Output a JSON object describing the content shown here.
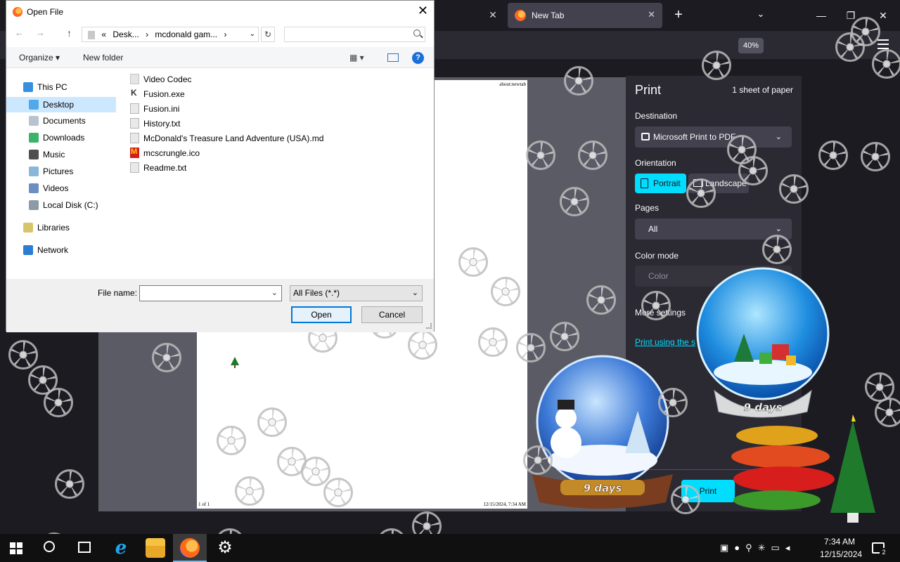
{
  "firefox": {
    "tab_title": "New Tab",
    "zoom": "40%"
  },
  "print_panel": {
    "title": "Print",
    "sheets": "1 sheet of paper",
    "destination_label": "Destination",
    "destination_value": "Microsoft Print to PDF",
    "orientation_label": "Orientation",
    "portrait": "Portrait",
    "landscape": "Landscape",
    "pages_label": "Pages",
    "pages_value": "All",
    "color_mode_label": "Color mode",
    "color_value": "Color",
    "more_settings": "More settings",
    "system_dialog_link": "Print using the s",
    "print_button": "Print"
  },
  "preview": {
    "header_url": "about:newtab",
    "footer_page": "1 of 1",
    "footer_date": "12/15/2024, 7:34 AM"
  },
  "globes": {
    "big_label": "9 days",
    "small_label": "9 days"
  },
  "dialog": {
    "title": "Open File",
    "address_prefix": "«",
    "address_part1": "Desk...",
    "address_part2": "mcdonald gam...",
    "address_sep": "›",
    "toolbar": {
      "organize": "Organize ▾",
      "new_folder": "New folder"
    },
    "nav_items": [
      {
        "label": "This PC"
      },
      {
        "label": "Desktop"
      },
      {
        "label": "Documents"
      },
      {
        "label": "Downloads"
      },
      {
        "label": "Music"
      },
      {
        "label": "Pictures"
      },
      {
        "label": "Videos"
      },
      {
        "label": "Local Disk (C:)"
      },
      {
        "label": "Libraries"
      },
      {
        "label": "Network"
      }
    ],
    "files": [
      {
        "name": "Video Codec"
      },
      {
        "name": "Fusion.exe"
      },
      {
        "name": "Fusion.ini"
      },
      {
        "name": "History.txt"
      },
      {
        "name": "McDonald's Treasure Land Adventure (USA).md"
      },
      {
        "name": "mcscrungle.ico"
      },
      {
        "name": "Readme.txt"
      }
    ],
    "file_name_label": "File name:",
    "file_name_value": "",
    "filter_value": "All Files (*.*)",
    "open_button": "Open",
    "cancel_button": "Cancel"
  },
  "taskbar": {
    "time": "7:34 AM",
    "date": "12/15/2024",
    "notification_count": "2"
  }
}
